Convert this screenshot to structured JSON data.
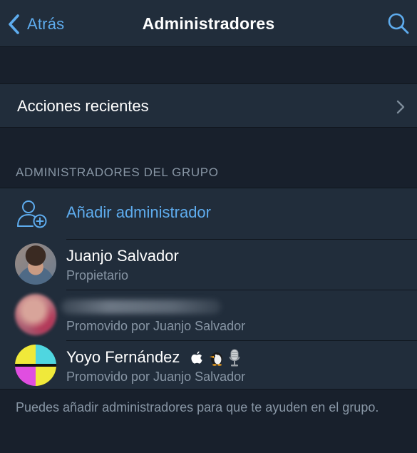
{
  "navbar": {
    "back_label": "Atrás",
    "title": "Administradores",
    "icons": {
      "back": "chevron-left-icon",
      "search": "search-icon"
    }
  },
  "recent_actions": {
    "label": "Acciones recientes",
    "icon": "chevron-right-icon"
  },
  "section": {
    "header": "ADMINISTRADORES DEL GRUPO"
  },
  "add_admin": {
    "label": "Añadir administrador",
    "icon": "add-user-icon"
  },
  "admins": [
    {
      "name": "Juanjo Salvador",
      "role": "Propietario"
    },
    {
      "name": "",
      "role": "Promovido por Juanjo Salvador",
      "name_obscured": true
    },
    {
      "name": "Yoyo Fernández",
      "role": "Promovido por Juanjo Salvador",
      "badges": [
        "apple-icon",
        "penguin-icon",
        "microphone-icon"
      ]
    }
  ],
  "footer": {
    "text": "Puedes añadir administradores para que te ayuden en el grupo."
  },
  "colors": {
    "accent": "#5eacee",
    "background": "#18202c",
    "cell_background": "#212d3b",
    "secondary_text": "#8896a5"
  }
}
